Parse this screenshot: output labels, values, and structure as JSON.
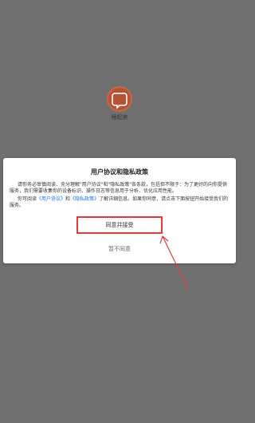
{
  "app": {
    "name": "睡起来"
  },
  "dialog": {
    "title": "用户协议和隐私政策",
    "para1": "请你务必审慎阅读、充分理解\"用户协议\"和\"隐私政策\"各条款，包括但不限于：为了更好的向你提供服务，我们需要收集你的设备标识、操作日志等信息用于分析、优化应用性能。",
    "para2_prefix": "你可阅读",
    "link_user_agreement": "《用户协议》",
    "para2_and": "和",
    "link_privacy_policy": "《隐私政策》",
    "para2_suffix": "了解详细信息。如果你同意，请点击下面按钮开始接受我们的服务。",
    "agree_label": "同意并接受",
    "disagree_label": "暂不同意"
  },
  "colors": {
    "overlay": "#6f6f6f",
    "logo": "#b35436",
    "highlight": "#e53935",
    "link": "#1a73e8"
  }
}
